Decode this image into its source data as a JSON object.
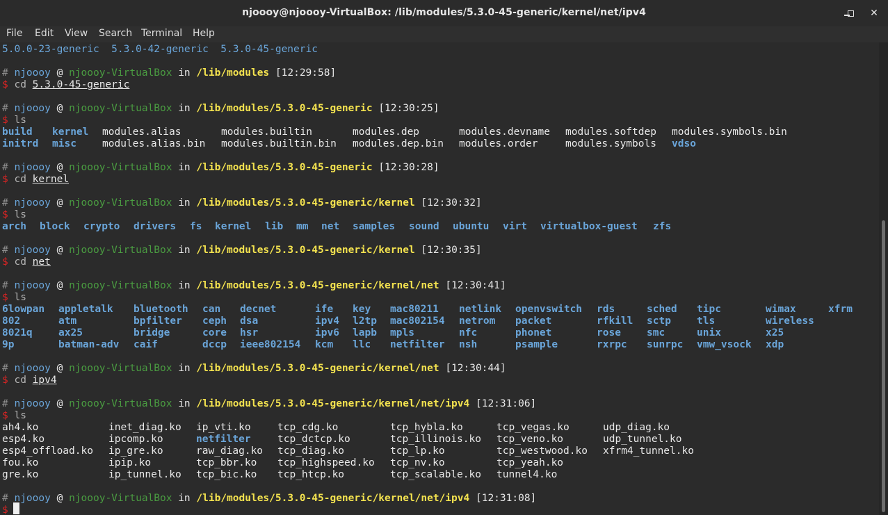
{
  "window": {
    "title": "njoooy@njoooy-VirtualBox: /lib/modules/5.3.0-45-generic/kernel/net/ipv4"
  },
  "menu": [
    "File",
    "Edit",
    "View",
    "Search",
    "Terminal",
    "Help"
  ],
  "prompt": {
    "hash": "#",
    "user": "njoooy",
    "at": "@",
    "host": "njoooy-VirtualBox",
    "in": "in",
    "dollar": "$"
  },
  "header_line": "5.0.0-23-generic  5.3.0-42-generic  5.3.0-45-generic",
  "blocks": [
    {
      "path": "/lib/modules",
      "time": "[12:29:58]",
      "cmd": "cd",
      "arg": "5.3.0-45-generic"
    },
    {
      "path": "/lib/modules/5.3.0-45-generic",
      "time": "[12:30:25]",
      "cmd": "ls",
      "arg": ""
    },
    {
      "path": "/lib/modules/5.3.0-45-generic",
      "time": "[12:30:28]",
      "cmd": "cd",
      "arg": "kernel"
    },
    {
      "path": "/lib/modules/5.3.0-45-generic/kernel",
      "time": "[12:30:32]",
      "cmd": "ls",
      "arg": ""
    },
    {
      "path": "/lib/modules/5.3.0-45-generic/kernel",
      "time": "[12:30:35]",
      "cmd": "cd",
      "arg": "net"
    },
    {
      "path": "/lib/modules/5.3.0-45-generic/kernel/net",
      "time": "[12:30:41]",
      "cmd": "ls",
      "arg": ""
    },
    {
      "path": "/lib/modules/5.3.0-45-generic/kernel/net",
      "time": "[12:30:44]",
      "cmd": "cd",
      "arg": "ipv4"
    },
    {
      "path": "/lib/modules/5.3.0-45-generic/kernel/net/ipv4",
      "time": "[12:31:06]",
      "cmd": "ls",
      "arg": ""
    },
    {
      "path": "/lib/modules/5.3.0-45-generic/kernel/net/ipv4",
      "time": "[12:31:08]",
      "cmd": "",
      "arg": ""
    }
  ],
  "ls_modules": [
    [
      {
        "t": "build",
        "d": true
      },
      {
        "t": "kernel",
        "d": true
      },
      {
        "t": "modules.alias",
        "d": false
      },
      {
        "t": "modules.builtin",
        "d": false
      },
      {
        "t": "modules.dep",
        "d": false
      },
      {
        "t": "modules.devname",
        "d": false
      },
      {
        "t": "modules.softdep",
        "d": false
      },
      {
        "t": "modules.symbols.bin",
        "d": false
      }
    ],
    [
      {
        "t": "initrd",
        "d": true
      },
      {
        "t": "misc",
        "d": true
      },
      {
        "t": "modules.alias.bin",
        "d": false
      },
      {
        "t": "modules.builtin.bin",
        "d": false
      },
      {
        "t": "modules.dep.bin",
        "d": false
      },
      {
        "t": "modules.order",
        "d": false
      },
      {
        "t": "modules.symbols",
        "d": false
      },
      {
        "t": "vdso",
        "d": true
      }
    ]
  ],
  "ls_kernel": [
    [
      {
        "t": "arch",
        "d": true
      },
      {
        "t": "block",
        "d": true
      },
      {
        "t": "crypto",
        "d": true
      },
      {
        "t": "drivers",
        "d": true
      },
      {
        "t": "fs",
        "d": true
      },
      {
        "t": "kernel",
        "d": true
      },
      {
        "t": "lib",
        "d": true
      },
      {
        "t": "mm",
        "d": true
      },
      {
        "t": "net",
        "d": true
      },
      {
        "t": "samples",
        "d": true
      },
      {
        "t": "sound",
        "d": true
      },
      {
        "t": "ubuntu",
        "d": true
      },
      {
        "t": "virt",
        "d": true
      },
      {
        "t": "virtualbox-guest",
        "d": true
      },
      {
        "t": "zfs",
        "d": true
      }
    ]
  ],
  "ls_net": [
    [
      {
        "t": "6lowpan",
        "d": true
      },
      {
        "t": "appletalk",
        "d": true
      },
      {
        "t": "bluetooth",
        "d": true
      },
      {
        "t": "can",
        "d": true
      },
      {
        "t": "decnet",
        "d": true
      },
      {
        "t": "ife",
        "d": true
      },
      {
        "t": "key",
        "d": true
      },
      {
        "t": "mac80211",
        "d": true
      },
      {
        "t": "netlink",
        "d": true
      },
      {
        "t": "openvswitch",
        "d": true
      },
      {
        "t": "rds",
        "d": true
      },
      {
        "t": "sched",
        "d": true
      },
      {
        "t": "tipc",
        "d": true
      },
      {
        "t": "wimax",
        "d": true
      },
      {
        "t": "xfrm",
        "d": true
      }
    ],
    [
      {
        "t": "802",
        "d": true
      },
      {
        "t": "atm",
        "d": true
      },
      {
        "t": "bpfilter",
        "d": true
      },
      {
        "t": "ceph",
        "d": true
      },
      {
        "t": "dsa",
        "d": true
      },
      {
        "t": "ipv4",
        "d": true
      },
      {
        "t": "l2tp",
        "d": true
      },
      {
        "t": "mac802154",
        "d": true
      },
      {
        "t": "netrom",
        "d": true
      },
      {
        "t": "packet",
        "d": true
      },
      {
        "t": "rfkill",
        "d": true
      },
      {
        "t": "sctp",
        "d": true
      },
      {
        "t": "tls",
        "d": true
      },
      {
        "t": "wireless",
        "d": true
      }
    ],
    [
      {
        "t": "8021q",
        "d": true
      },
      {
        "t": "ax25",
        "d": true
      },
      {
        "t": "bridge",
        "d": true
      },
      {
        "t": "core",
        "d": true
      },
      {
        "t": "hsr",
        "d": true
      },
      {
        "t": "ipv6",
        "d": true
      },
      {
        "t": "lapb",
        "d": true
      },
      {
        "t": "mpls",
        "d": true
      },
      {
        "t": "nfc",
        "d": true
      },
      {
        "t": "phonet",
        "d": true
      },
      {
        "t": "rose",
        "d": true
      },
      {
        "t": "smc",
        "d": true
      },
      {
        "t": "unix",
        "d": true
      },
      {
        "t": "x25",
        "d": true
      }
    ],
    [
      {
        "t": "9p",
        "d": true
      },
      {
        "t": "batman-adv",
        "d": true
      },
      {
        "t": "caif",
        "d": true
      },
      {
        "t": "dccp",
        "d": true
      },
      {
        "t": "ieee802154",
        "d": true
      },
      {
        "t": "kcm",
        "d": true
      },
      {
        "t": "llc",
        "d": true
      },
      {
        "t": "netfilter",
        "d": true
      },
      {
        "t": "nsh",
        "d": true
      },
      {
        "t": "psample",
        "d": true
      },
      {
        "t": "rxrpc",
        "d": true
      },
      {
        "t": "sunrpc",
        "d": true
      },
      {
        "t": "vmw_vsock",
        "d": true
      },
      {
        "t": "xdp",
        "d": true
      }
    ]
  ],
  "ls_ipv4": [
    [
      {
        "t": "ah4.ko",
        "d": false
      },
      {
        "t": "inet_diag.ko",
        "d": false
      },
      {
        "t": "ip_vti.ko",
        "d": false
      },
      {
        "t": "tcp_cdg.ko",
        "d": false
      },
      {
        "t": "tcp_hybla.ko",
        "d": false
      },
      {
        "t": "tcp_vegas.ko",
        "d": false
      },
      {
        "t": "udp_diag.ko",
        "d": false
      }
    ],
    [
      {
        "t": "esp4.ko",
        "d": false
      },
      {
        "t": "ipcomp.ko",
        "d": false
      },
      {
        "t": "netfilter",
        "d": true
      },
      {
        "t": "tcp_dctcp.ko",
        "d": false
      },
      {
        "t": "tcp_illinois.ko",
        "d": false
      },
      {
        "t": "tcp_veno.ko",
        "d": false
      },
      {
        "t": "udp_tunnel.ko",
        "d": false
      }
    ],
    [
      {
        "t": "esp4_offload.ko",
        "d": false
      },
      {
        "t": "ip_gre.ko",
        "d": false
      },
      {
        "t": "raw_diag.ko",
        "d": false
      },
      {
        "t": "tcp_diag.ko",
        "d": false
      },
      {
        "t": "tcp_lp.ko",
        "d": false
      },
      {
        "t": "tcp_westwood.ko",
        "d": false
      },
      {
        "t": "xfrm4_tunnel.ko",
        "d": false
      }
    ],
    [
      {
        "t": "fou.ko",
        "d": false
      },
      {
        "t": "ipip.ko",
        "d": false
      },
      {
        "t": "tcp_bbr.ko",
        "d": false
      },
      {
        "t": "tcp_highspeed.ko",
        "d": false
      },
      {
        "t": "tcp_nv.ko",
        "d": false
      },
      {
        "t": "tcp_yeah.ko",
        "d": false
      }
    ],
    [
      {
        "t": "gre.ko",
        "d": false
      },
      {
        "t": "ip_tunnel.ko",
        "d": false
      },
      {
        "t": "tcp_bic.ko",
        "d": false
      },
      {
        "t": "tcp_htcp.ko",
        "d": false
      },
      {
        "t": "tcp_scalable.ko",
        "d": false
      },
      {
        "t": "tunnel4.ko",
        "d": false
      }
    ]
  ]
}
